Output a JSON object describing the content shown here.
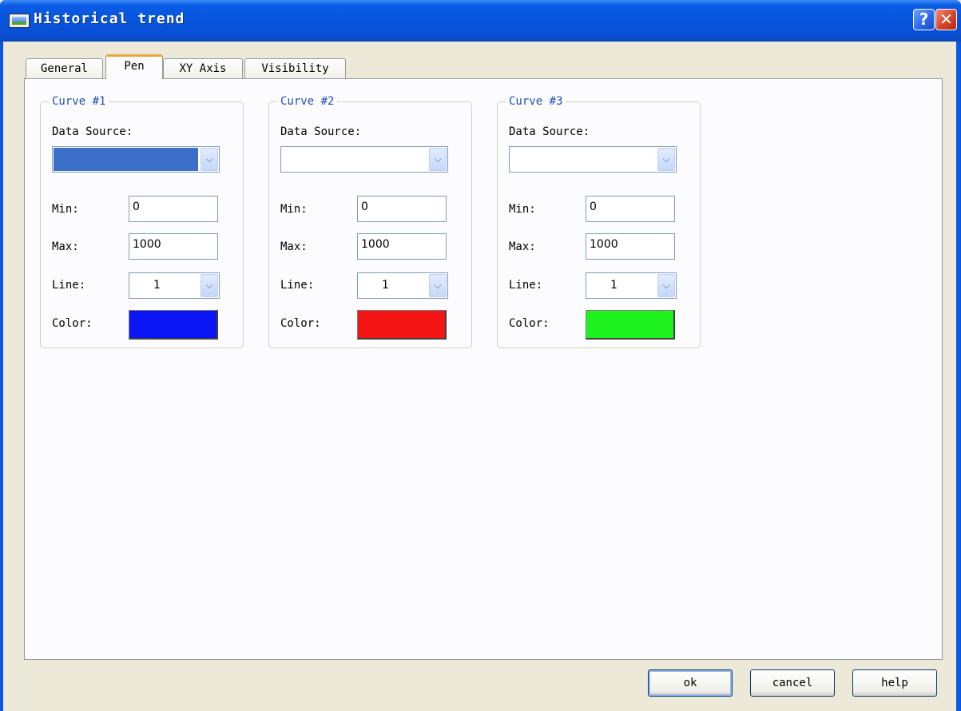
{
  "window": {
    "title": "Historical trend",
    "help_button": "?",
    "close_button": "✕"
  },
  "tabs": [
    "General",
    "Pen",
    "XY Axis",
    "Visibility"
  ],
  "active_tab": "Pen",
  "labels": {
    "data_source": "Data Source:",
    "min": "Min:",
    "max": "Max:",
    "line": "Line:",
    "color": "Color:"
  },
  "curves": [
    {
      "title": "Curve #1",
      "data_source": "",
      "min": "0",
      "max": "1000",
      "line": "1",
      "color": "#0a14f5"
    },
    {
      "title": "Curve #2",
      "data_source": "",
      "min": "0",
      "max": "1000",
      "line": "1",
      "color": "#f51414"
    },
    {
      "title": "Curve #3",
      "data_source": "",
      "min": "0",
      "max": "1000",
      "line": "1",
      "color": "#1ef21e"
    }
  ],
  "data_source_selected_color": "#3b6fc9",
  "buttons": {
    "ok": "ok",
    "cancel": "cancel",
    "help": "help"
  }
}
